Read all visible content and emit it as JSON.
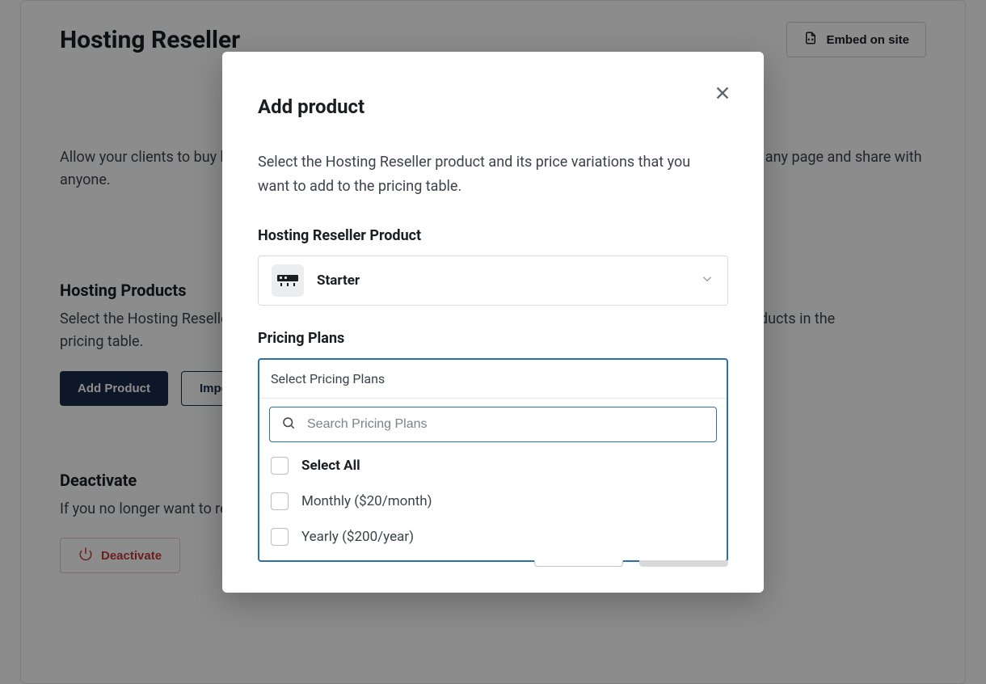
{
  "page": {
    "title": "Hosting Reseller",
    "embed_label": "Embed on site",
    "lead": "Allow your clients to buy hosting products from you by setting up a clean pricing table that you can embed on any page and share with anyone."
  },
  "products_section": {
    "heading": "Hosting Products",
    "desc": "Select the Hosting Reseller products you want to add and set their prices. Add new or update the existing products in the pricing table.",
    "add_label": "Add Product",
    "import_label": "Import"
  },
  "deactivate_section": {
    "heading": "Deactivate",
    "desc": "If you no longer want to resell hosting, deactivate the reseller module.",
    "button_label": "Deactivate"
  },
  "modal": {
    "title": "Add product",
    "desc": "Select the Hosting Reseller product and its price variations that you want to add to the pricing table.",
    "product_label": "Hosting Reseller Product",
    "selected_product": "Starter",
    "pricing_label": "Pricing Plans",
    "dropdown": {
      "placeholder_header": "Select Pricing Plans",
      "search_placeholder": "Search Pricing Plans",
      "select_all_label": "Select All",
      "options": [
        {
          "label": "Monthly ($20/month)"
        },
        {
          "label": "Yearly ($200/year)"
        }
      ]
    }
  }
}
